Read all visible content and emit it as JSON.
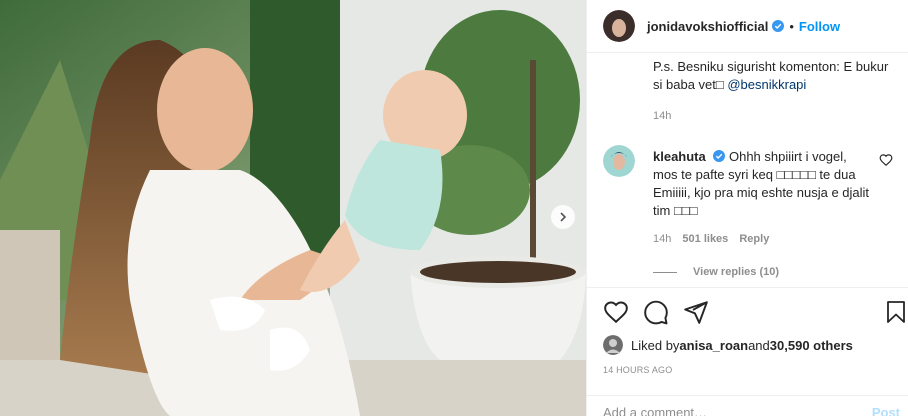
{
  "post": {
    "username": "jonidavokshiofficial",
    "dot": "•",
    "follow_label": "Follow"
  },
  "caption": {
    "text": "P.s. Besniku sigurisht komenton: E bukur si baba vet□ ",
    "mention": "@besnikkrapi",
    "time": "14h"
  },
  "comment": {
    "username": "kleahuta",
    "text": " Ohhh shpiiirt i vogel, mos te pafte syri keq □□□□□ te dua Emiiiii, kjo pra miq eshte nusja e djalit tim □□□",
    "time": "14h",
    "likes": "501 likes",
    "reply_label": "Reply",
    "view_replies": "View replies (10)"
  },
  "likes": {
    "prefix": "Liked by ",
    "user": "anisa_roan",
    "middle": " and ",
    "count": "30,590 others"
  },
  "timestamp": "14 HOURS AGO",
  "add_comment": {
    "placeholder": "Add a comment…",
    "post_label": "Post"
  },
  "colors": {
    "accent": "#0095f6",
    "verified": "#3897f0",
    "muted": "#8e8e8e"
  }
}
